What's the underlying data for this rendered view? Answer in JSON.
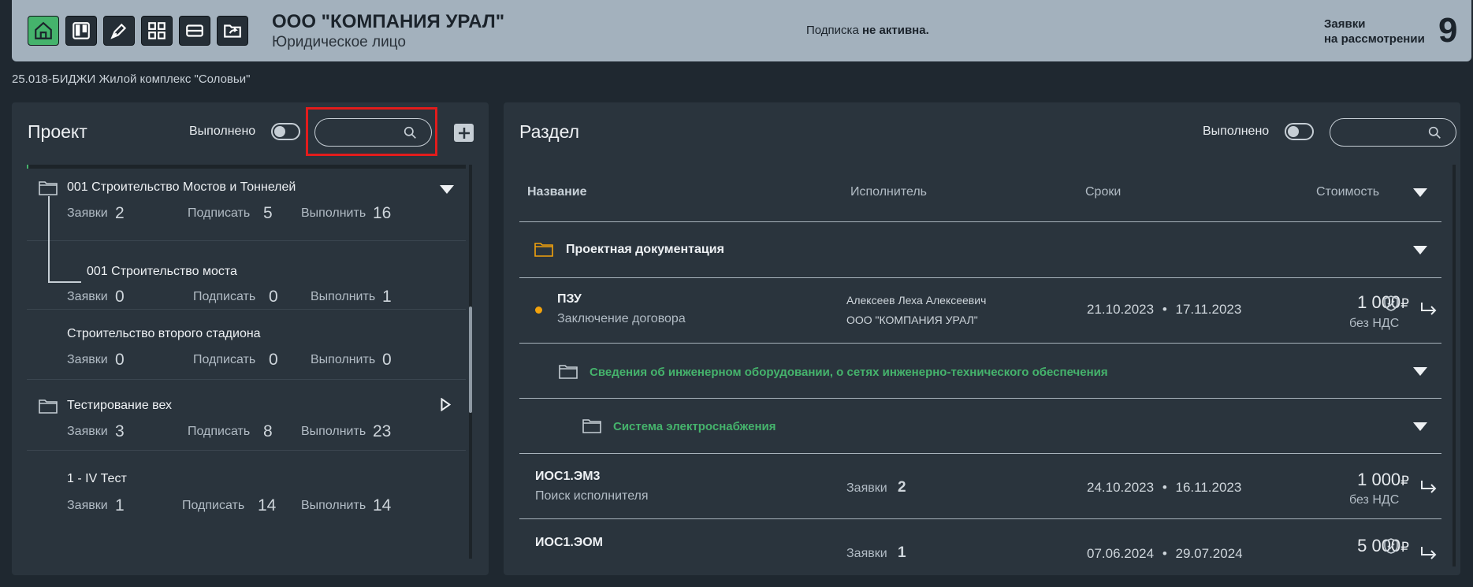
{
  "header": {
    "company_name": "ООО \"КОМПАНИЯ УРАЛ\"",
    "company_type": "Юридическое лицо",
    "subscription_text": "Подписка",
    "subscription_status": "не активна.",
    "requests_label_1": "Заявки",
    "requests_label_2": "на рассмотрении",
    "requests_count": "9",
    "buttons": [
      "home-icon",
      "kanban-icon",
      "pen-icon",
      "dashboard-icon",
      "stack-icon",
      "folder-share-icon"
    ],
    "accent_color": "#45b36c"
  },
  "breadcrumb": "25.018-БИДЖИ Жилой комплекс \"Соловьи\"",
  "left_panel": {
    "title": "Проект",
    "done_label": "Выполнено",
    "search_placeholder": "",
    "projects": [
      {
        "name": "001 Строительство Мостов и Тоннелей",
        "requests_label": "Заявки",
        "requests": "2",
        "sign_label": "Подписать",
        "sign": "5",
        "execute_label": "Выполнить",
        "execute": "16"
      },
      {
        "name": "001 Строительство моста",
        "requests_label": "Заявки",
        "requests": "0",
        "sign_label": "Подписать",
        "sign": "0",
        "execute_label": "Выполнить",
        "execute": "1"
      },
      {
        "name": "Строительство второго стадиона",
        "requests_label": "Заявки",
        "requests": "0",
        "sign_label": "Подписать",
        "sign": "0",
        "execute_label": "Выполнить",
        "execute": "0"
      },
      {
        "name": "Тестирование вех",
        "requests_label": "Заявки",
        "requests": "3",
        "sign_label": "Подписать",
        "sign": "8",
        "execute_label": "Выполнить",
        "execute": "23"
      },
      {
        "name": "1 - IV Тест",
        "requests_label": "Заявки",
        "requests": "1",
        "sign_label": "Подписать",
        "sign": "14",
        "execute_label": "Выполнить",
        "execute": "14"
      }
    ]
  },
  "right_panel": {
    "title": "Раздел",
    "done_label": "Выполнено",
    "search_placeholder": "",
    "columns": {
      "name": "Название",
      "executor": "Исполнитель",
      "dates": "Сроки",
      "cost": "Стоимость"
    },
    "folder_1": "Проектная документация",
    "row_1": {
      "code": "ПЗУ",
      "status": "Заключение договора",
      "executor_name": "Алексеев Леха Алексеевич",
      "executor_org": "ООО \"КОМПАНИЯ УРАЛ\"",
      "date_start": "21.10.2023",
      "date_end": "17.11.2023",
      "price": "1 000",
      "currency": "₽",
      "vat": "без НДС",
      "status_color": "#f2a20c"
    },
    "folder_2": "Сведения об инженерном оборудовании, о сетях инженерно-технического обеспечения",
    "folder_3": "Система электроснабжения",
    "row_2": {
      "code": "ИОС1.ЭМ3",
      "status": "Поиск исполнителя",
      "requests_label": "Заявки",
      "requests": "2",
      "date_start": "24.10.2023",
      "date_end": "16.11.2023",
      "price": "1 000",
      "currency": "₽",
      "vat": "без НДС"
    },
    "row_3": {
      "code": "ИОС1.ЭОМ",
      "requests_label": "Заявки",
      "requests": "1",
      "date_start": "07.06.2024",
      "date_end": "29.07.2024",
      "price": "5 000",
      "currency": "₽"
    },
    "date_separator": "•"
  }
}
